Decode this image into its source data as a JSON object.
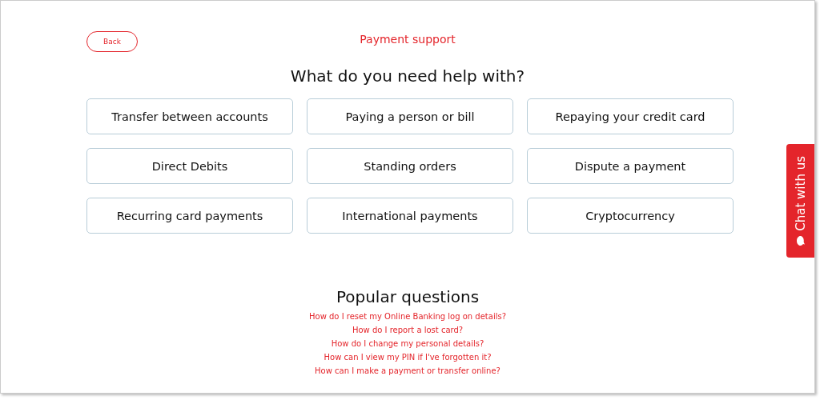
{
  "back_button": "Back",
  "page_title": "Payment support",
  "heading": "What do you need help with?",
  "topics": [
    "Transfer between accounts",
    "Paying a person or bill",
    "Repaying your credit card",
    "Direct Debits",
    "Standing orders",
    "Dispute a payment",
    "Recurring card payments",
    "International payments",
    "Cryptocurrency"
  ],
  "popular_questions": {
    "title": "Popular questions",
    "links": [
      "How do I reset my Online Banking log on details?",
      "How do I report a lost card?",
      "How do I change my personal details?",
      "How can I view my PIN if I've forgotten it?",
      "How can I make a payment or transfer online?"
    ]
  },
  "chat_button": "Chat with us"
}
